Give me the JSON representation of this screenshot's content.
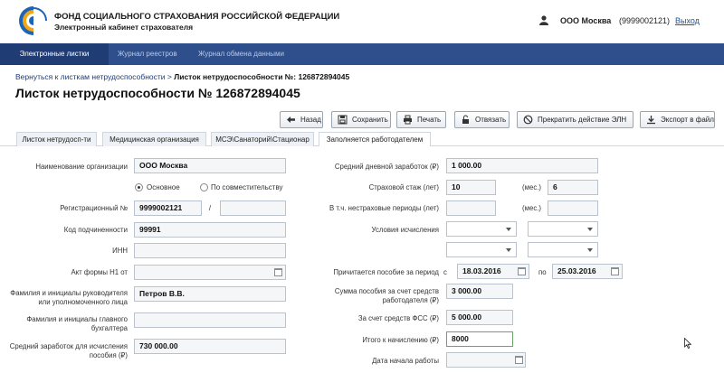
{
  "header": {
    "org_name": "ФОНД СОЦИАЛЬНОГО СТРАХОВАНИЯ РОССИЙСКОЙ ФЕДЕРАЦИИ",
    "cabinet": "Электронный кабинет страхователя",
    "user_name": "ООО Москва",
    "user_id": "(9999002121)",
    "logout": "Выход"
  },
  "nav": [
    "Электронные листки",
    "Журнал реестров",
    "Журнал обмена данными"
  ],
  "breadcrumb": {
    "back_link": "Вернуться к листкам нетрудоспособности",
    "separator": ">",
    "current": "Листок нетрудоспособности №: 126872894045"
  },
  "title": "Листок нетрудоспособности № 126872894045",
  "toolbar": {
    "back": "Назад",
    "save": "Сохранить",
    "print": "Печать",
    "unbind": "Отвязать",
    "terminate": "Прекратить действие ЭЛН",
    "export": "Экспорт в файл"
  },
  "tabs": [
    "Листок нетрудосп-ти",
    "Медицинская организация",
    "МСЭ\\Санаторий\\Стационар",
    "Заполняется работодателем"
  ],
  "left": {
    "org_label": "Наименование организации",
    "org_value": "ООО Москва",
    "radio_main": "Основное",
    "radio_part": "По совместительству",
    "reg_label": "Регистрационный №",
    "reg_value": "9999002121",
    "reg_sep": "/",
    "code_label": "Код подчиненности",
    "code_value": "99991",
    "inn_label": "ИНН",
    "act_label": "Акт формы Н1 от",
    "head_label": "Фамилия и инициалы руководителя или уполномоченного лица",
    "head_value": "Петров В.В.",
    "acc_label": "Фамилия и инициалы главного бухгалтера",
    "avg_label": "Средний заработок для исчисления пособия (₽)",
    "avg_value": "730 000.00"
  },
  "right": {
    "daily_label": "Средний дневной заработок (₽)",
    "daily_value": "1 000.00",
    "exp_label": "Страховой стаж (лет)",
    "exp_years": "10",
    "exp_months_label": "(мес.)",
    "exp_months": "6",
    "nonins_label": "В т.ч. нестраховые периоды (лет)",
    "nonins_months_label": "(мес.)",
    "cond_label": "Условия исчисления",
    "period_label": "Причитается пособие за период",
    "period_from_label": "с",
    "period_from": "18.03.2016",
    "period_to_label": "по",
    "period_to": "25.03.2016",
    "employer_label": "Сумма пособия за счет средств работодателя (₽)",
    "employer_value": "3 000.00",
    "fss_label": "За счет средств ФСС (₽)",
    "fss_value": "5 000.00",
    "total_label": "Итого к начислению (₽)",
    "total_value": "8000",
    "start_label": "Дата начала работы"
  }
}
